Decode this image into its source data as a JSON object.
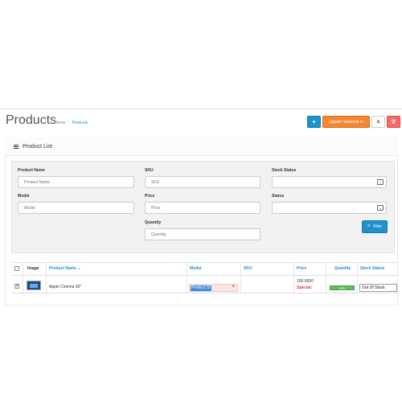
{
  "header": {
    "title": "Products",
    "breadcrumb": [
      "Home",
      "Products"
    ],
    "buttons": {
      "add_label": "+",
      "update_label": "Update Selected ⟳",
      "copy_label": "⧉",
      "delete_label": "🗑"
    }
  },
  "panel": {
    "title": "Product List"
  },
  "filter": {
    "product_name": {
      "label": "Product Name",
      "placeholder": "Product Name"
    },
    "sku": {
      "label": "SKU",
      "placeholder": "SKU"
    },
    "stock_status": {
      "label": "Stock Status",
      "value": ""
    },
    "model": {
      "label": "Model",
      "placeholder": "Model"
    },
    "price": {
      "label": "Price",
      "placeholder": "Price"
    },
    "status": {
      "label": "Status",
      "value": ""
    },
    "quantity": {
      "label": "Quantity",
      "placeholder": "Quantity"
    },
    "filter_button": "🔍 Filter"
  },
  "table": {
    "headers": {
      "image": "Image",
      "product_name": "Product Name ⌄",
      "model": "Model",
      "sku": "SKU",
      "price": "Price",
      "quantity": "Quantity",
      "stock_status": "Stock Status"
    },
    "rows": [
      {
        "checked": true,
        "image": "monitor-thumbnail",
        "name": "Apple Cinema 30\"",
        "model_edit": "Product 15",
        "sku": "",
        "price": "100.0000",
        "special": "Special:",
        "quantity": "990",
        "stock_status": "Out Of Stock"
      }
    ]
  },
  "colors": {
    "primary": "#1e91cf",
    "warning": "#f38733",
    "danger": "#f56b6b",
    "success": "#5ebd5e"
  }
}
